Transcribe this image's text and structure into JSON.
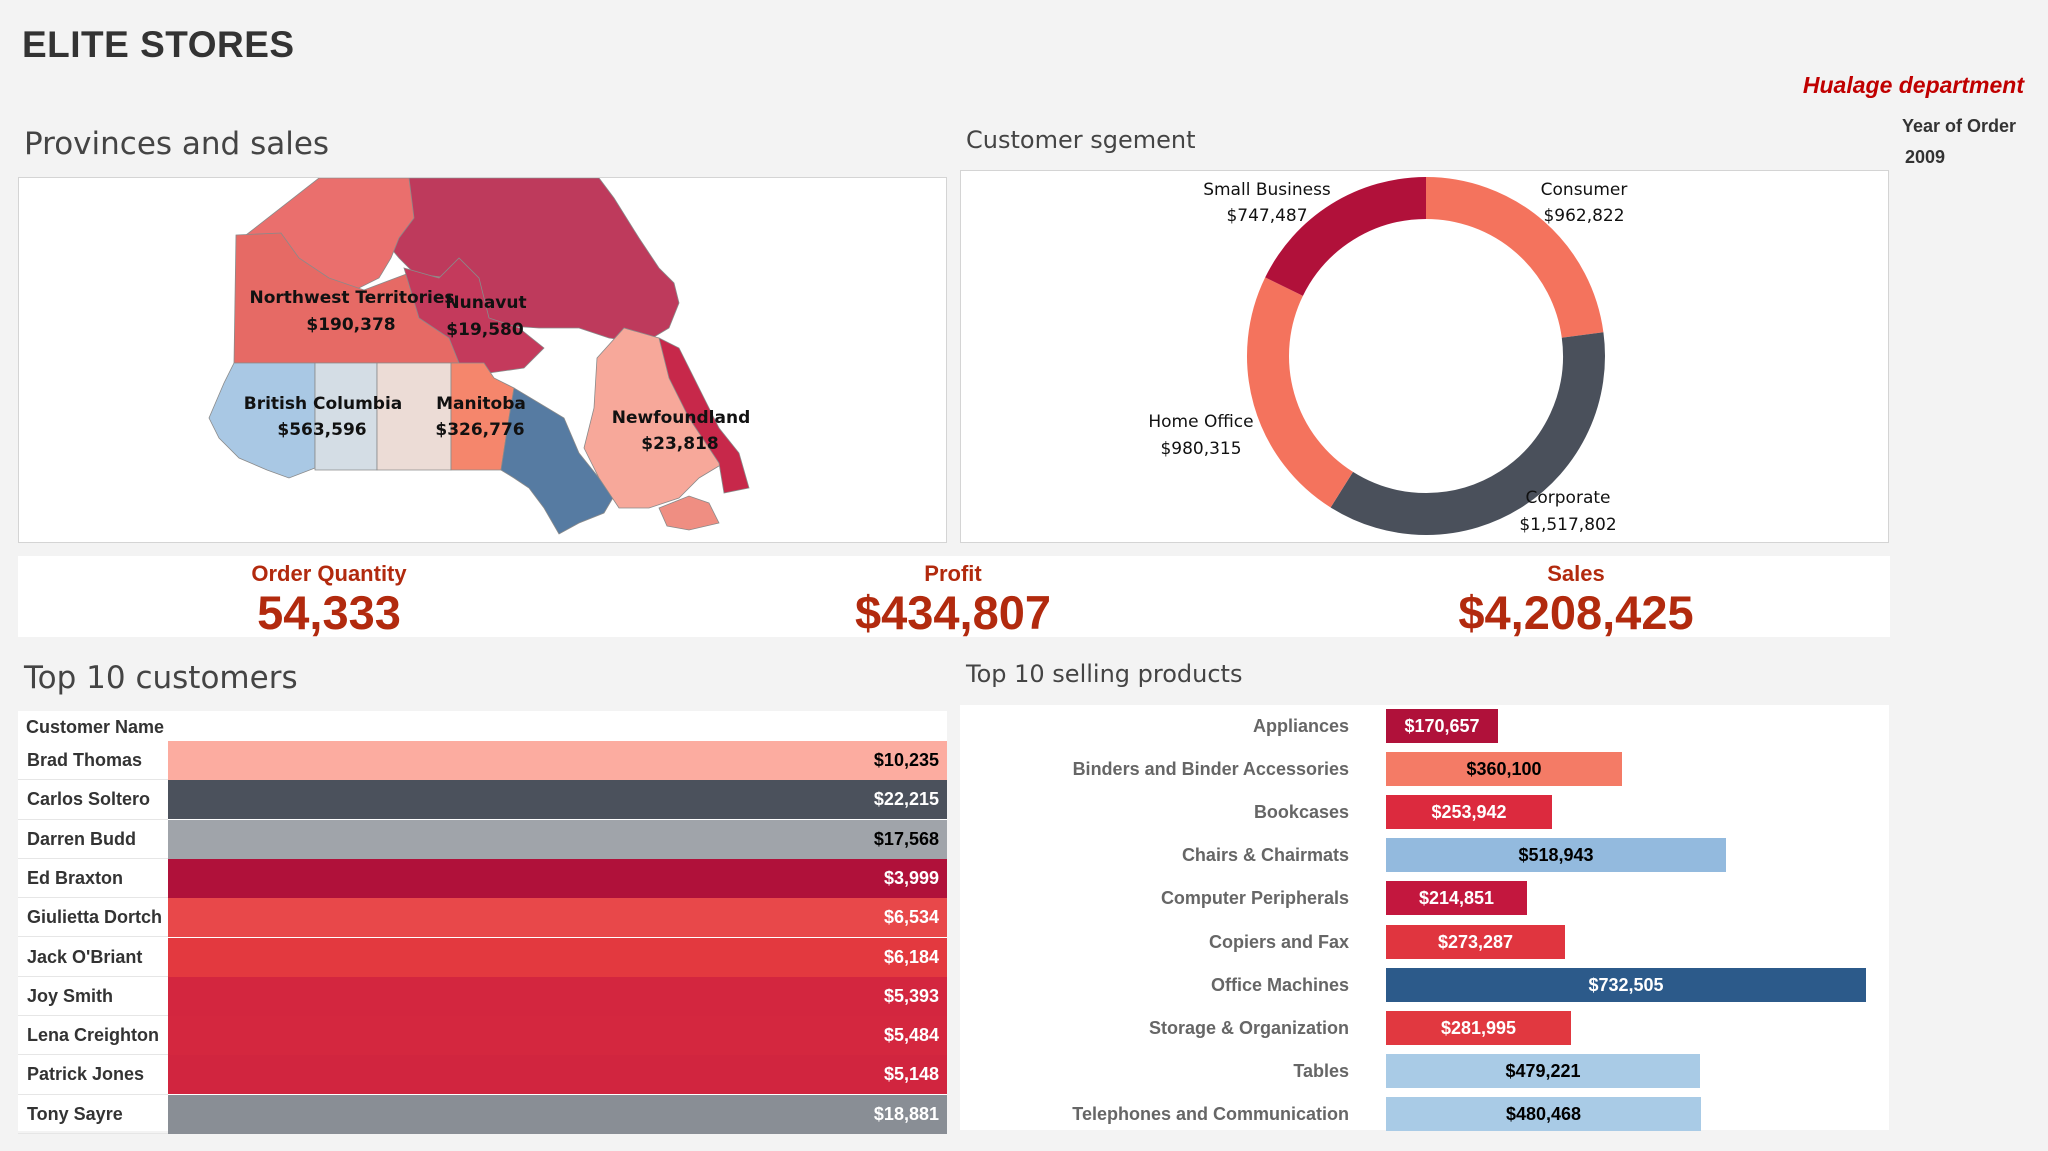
{
  "header": {
    "title": "ELITE STORES",
    "department": "Hualage department"
  },
  "filter": {
    "label": "Year of Order",
    "value": "2009"
  },
  "sections": {
    "provinces": "Provinces and sales",
    "segment": "Customer sgement",
    "customers": "Top 10 customers",
    "products": "Top 10 selling products"
  },
  "map": {
    "labels": [
      {
        "name": "Northwest Territories",
        "value": "$190,378"
      },
      {
        "name": "Nunavut",
        "value": "$19,580"
      },
      {
        "name": "British Columbia",
        "value": "$563,596"
      },
      {
        "name": "Manitoba",
        "value": "$326,776"
      },
      {
        "name": "Newfoundland",
        "value": "$23,818"
      }
    ],
    "colors": {
      "north": "#be3a5c",
      "yukon": "#ea6f6d",
      "nwt": "#e66a65",
      "nunavut": "#c43a5c",
      "bc": "#a9c8e4",
      "alberta": "#d4dde5",
      "saskatchewan": "#ecdcd6",
      "manitoba": "#f5866c",
      "ontario": "#567ba2",
      "quebec": "#f7a89a",
      "labrador": "#c7284a",
      "maritimes": "#ef8e82"
    }
  },
  "segments": {
    "items": [
      {
        "name": "Consumer",
        "value": "$962,822",
        "amount": 962822,
        "color": "#f4735d"
      },
      {
        "name": "Corporate",
        "value": "$1,517,802",
        "amount": 1517802,
        "color": "#4a505b"
      },
      {
        "name": "Home Office",
        "value": "$980,315",
        "amount": 980315,
        "color": "#f4735d"
      },
      {
        "name": "Small Business",
        "value": "$747,487",
        "amount": 747487,
        "color": "#b1113a"
      }
    ]
  },
  "kpis": {
    "order_quantity": {
      "label": "Order Quantity",
      "value": "54,333"
    },
    "profit": {
      "label": "Profit",
      "value": "$434,807"
    },
    "sales": {
      "label": "Sales",
      "value": "$4,208,425"
    }
  },
  "customers": {
    "column_header": "Customer Name",
    "rows": [
      {
        "name": "Brad Thomas",
        "value": "$10,235",
        "color": "#fcaca0",
        "text": "#000000"
      },
      {
        "name": "Carlos Soltero",
        "value": "$22,215",
        "color": "#4b515c",
        "text": "#ffffff"
      },
      {
        "name": "Darren Budd",
        "value": "$17,568",
        "color": "#a0a4aa",
        "text": "#000000"
      },
      {
        "name": "Ed Braxton",
        "value": "$3,999",
        "color": "#b0113a",
        "text": "#ffffff"
      },
      {
        "name": "Giulietta Dortch",
        "value": "$6,534",
        "color": "#e8484a",
        "text": "#ffffff"
      },
      {
        "name": "Jack O'Briant",
        "value": "$6,184",
        "color": "#e3393f",
        "text": "#ffffff"
      },
      {
        "name": "Joy Smith",
        "value": "$5,393",
        "color": "#d3263f",
        "text": "#ffffff"
      },
      {
        "name": "Lena Creighton",
        "value": "$5,484",
        "color": "#d4273f",
        "text": "#ffffff"
      },
      {
        "name": "Patrick Jones",
        "value": "$5,148",
        "color": "#d1253f",
        "text": "#ffffff"
      },
      {
        "name": "Tony Sayre",
        "value": "$18,881",
        "color": "#898e95",
        "text": "#ffffff"
      }
    ]
  },
  "chart_data": {
    "type": "bar",
    "orientation": "horizontal",
    "title": "Top 10 selling products",
    "categories": [
      "Appliances",
      "Binders and Binder Accessories",
      "Bookcases",
      "Chairs & Chairmats",
      "Computer Peripherals",
      "Copiers and Fax",
      "Office Machines",
      "Storage & Organization",
      "Tables",
      "Telephones and Communication"
    ],
    "values": [
      170657,
      360100,
      253942,
      518943,
      214851,
      273287,
      732505,
      281995,
      479221,
      480468
    ],
    "labels": [
      "$170,657",
      "$360,100",
      "$253,942",
      "$518,943",
      "$214,851",
      "$273,287",
      "$732,505",
      "$281,995",
      "$479,221",
      "$480,468"
    ],
    "colors": [
      "#b0113a",
      "#f47b66",
      "#dc2a3e",
      "#93bade",
      "#c3173e",
      "#e0353f",
      "#2c5a8a",
      "#e13840",
      "#a9cbe6",
      "#a9cbe6"
    ],
    "label_colors": [
      "#ffffff",
      "#000000",
      "#ffffff",
      "#000000",
      "#ffffff",
      "#ffffff",
      "#ffffff",
      "#ffffff",
      "#000000",
      "#000000"
    ]
  }
}
